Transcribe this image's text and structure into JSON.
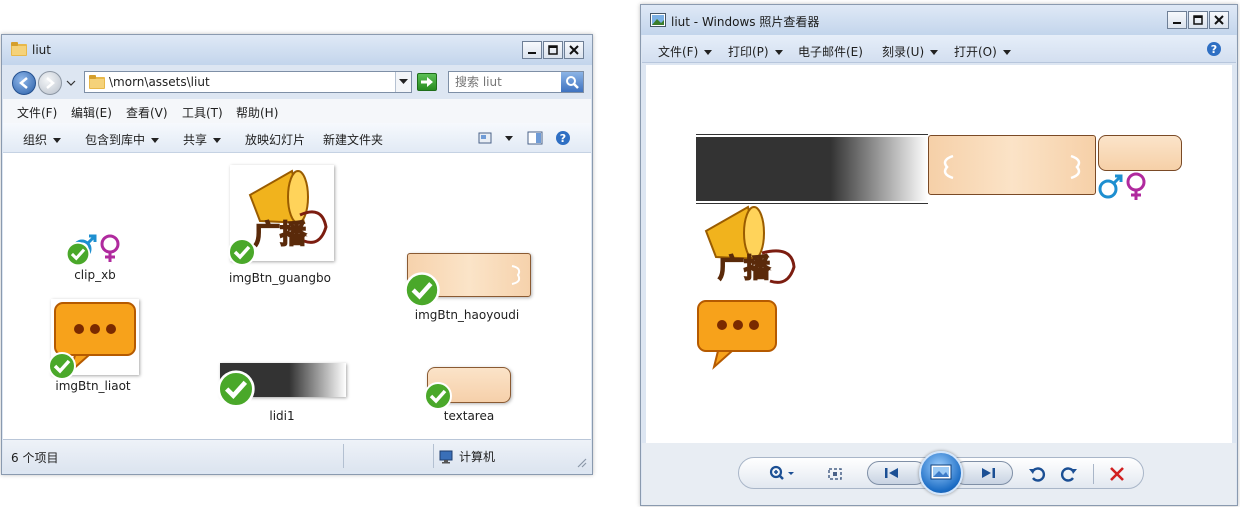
{
  "explorer": {
    "title": "liut",
    "address": "\\morn\\assets\\liut",
    "search_placeholder": "搜索 liut",
    "menu": [
      "文件(F)",
      "编辑(E)",
      "查看(V)",
      "工具(T)",
      "帮助(H)"
    ],
    "commands": {
      "organize": "组织",
      "include_library": "包含到库中",
      "share": "共享",
      "slideshow": "放映幻灯片",
      "new_folder": "新建文件夹"
    },
    "files": [
      {
        "name": "clip_xb",
        "status": "synced"
      },
      {
        "name": "imgBtn_guangbo",
        "status": "synced"
      },
      {
        "name": "imgBtn_haoyoudi",
        "status": "synced"
      },
      {
        "name": "imgBtn_liaot",
        "status": "synced"
      },
      {
        "name": "lidi1",
        "status": "synced"
      },
      {
        "name": "textarea",
        "status": "synced"
      }
    ],
    "status": {
      "count": "6 个项目",
      "location": "计算机"
    }
  },
  "viewer": {
    "title": "liut - Windows 照片查看器",
    "menu": [
      {
        "label": "文件(F)",
        "dropdown": true
      },
      {
        "label": "打印(P)",
        "dropdown": true
      },
      {
        "label": "电子邮件(E)",
        "dropdown": false
      },
      {
        "label": "刻录(U)",
        "dropdown": true
      },
      {
        "label": "打开(O)",
        "dropdown": true
      }
    ],
    "image_text": {
      "broadcast": "广播"
    }
  },
  "colors": {
    "check_green": "#4aa82a",
    "peach": "#f7d2a8",
    "orange": "#f7a21b",
    "delete_red": "#d12020",
    "male_blue": "#1e8fd0",
    "female_purple": "#b02a9e"
  }
}
